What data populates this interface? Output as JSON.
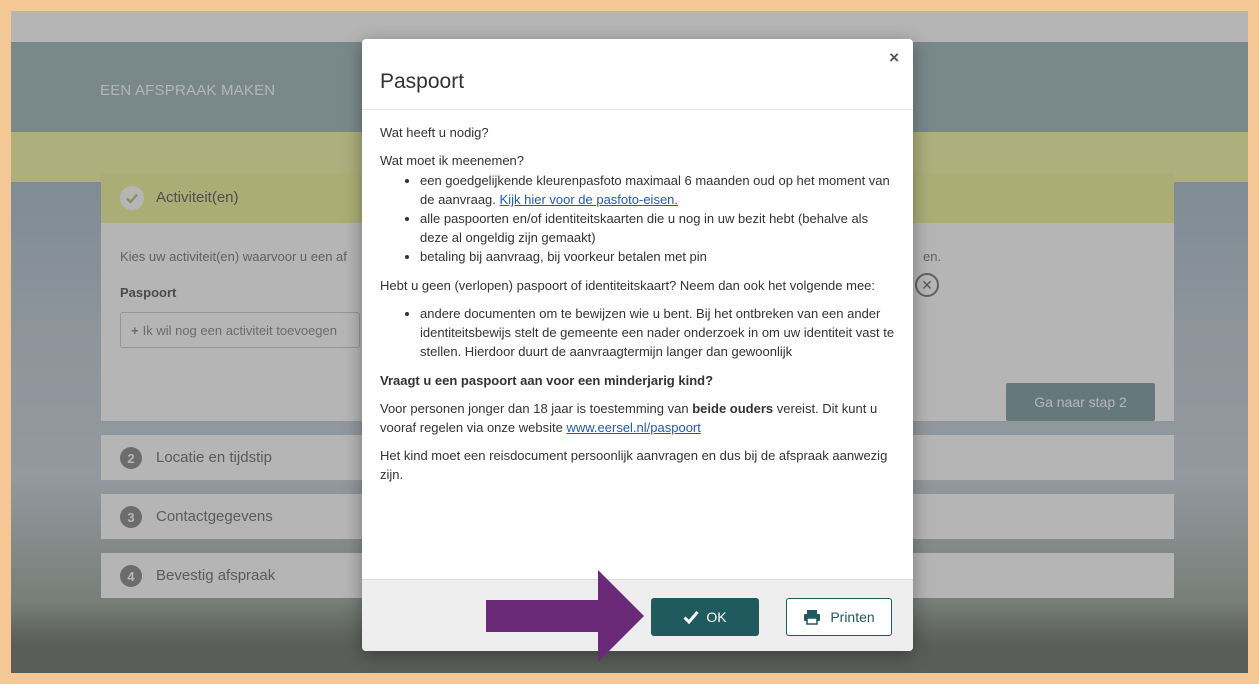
{
  "header": {
    "title": "EEN AFSPRAAK MAKEN"
  },
  "step1": {
    "title": "Activiteit(en)",
    "description": "Kies uw activiteit(en) waarvoor u een af",
    "description_tail": "en.",
    "activity_label": "Paspoort",
    "add_activity": "Ik wil nog een activiteit toevoegen",
    "next_button": "Ga naar stap 2"
  },
  "steps": [
    {
      "number": "2",
      "label": "Locatie en tijdstip"
    },
    {
      "number": "3",
      "label": "Contactgegevens"
    },
    {
      "number": "4",
      "label": "Bevestig afspraak"
    }
  ],
  "modal": {
    "close": "×",
    "title": "Paspoort",
    "q1": "Wat heeft u nodig?",
    "q2": "Wat moet ik meenemen?",
    "list1": {
      "item1_text": "een goedgelijkende kleurenpasfoto maximaal 6 maanden oud op het moment van de aanvraag.",
      "item1_link": "Kijk hier voor de pasfoto-eisen.",
      "item2": "alle paspoorten en/of identiteitskaarten die u nog in uw bezit hebt (behalve als deze al ongeldig zijn gemaakt)",
      "item3": "betaling bij aanvraag, bij voorkeur betalen met pin"
    },
    "p3": "Hebt u geen (verlopen) paspoort of identiteitskaart? Neem dan ook het volgende mee:",
    "list2": {
      "item1": "andere documenten om te bewijzen wie u bent. Bij het ontbreken van een ander identiteitsbewijs stelt de gemeente een nader onderzoek in om uw identiteit vast te stellen. Hierdoor duurt de aanvraagtermijn langer dan gewoonlijk"
    },
    "minor_heading": "Vraagt u een paspoort aan voor een minderjarig kind?",
    "minor_p1_a": "Voor personen jonger dan 18 jaar is toestemming van",
    "minor_p1_bold": "beide ouders",
    "minor_p1_b": "vereist. Dit kunt u vooraf regelen via onze website",
    "minor_link": "www.eersel.nl/paspoort",
    "minor_p2": "Het kind moet een reisdocument persoonlijk aanvragen en dus bij de afspraak aanwezig zijn.",
    "ok_label": "OK",
    "print_label": "Printen"
  },
  "colors": {
    "frame": "#f5c795",
    "header": "#9eb6bc",
    "yellow": "#f2f5a4",
    "primary": "#1f5a5f",
    "arrow": "#6b2a78",
    "link": "#1f5bb5"
  },
  "icons": {
    "check": "check-icon",
    "plus": "plus-icon",
    "remove": "close-circle-icon",
    "ok": "check-icon",
    "print": "printer-icon",
    "arrow": "arrow-right-icon"
  }
}
